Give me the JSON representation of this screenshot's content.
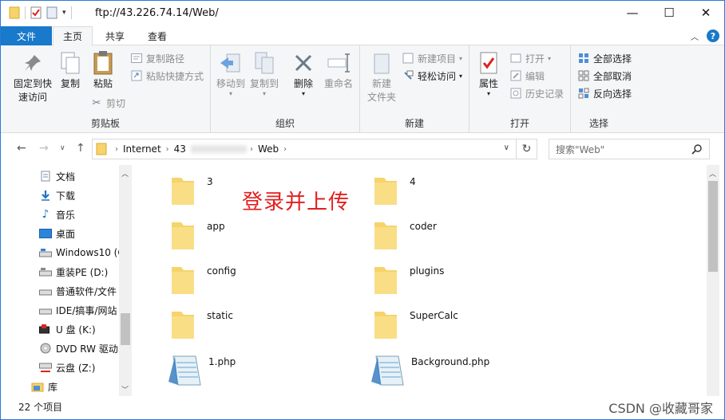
{
  "window": {
    "title": "ftp://43.226.74.14/Web/",
    "controls": {
      "minimize": "—",
      "maximize": "☐",
      "close": "✕"
    }
  },
  "ribbon_tabs": [
    {
      "label": "文件"
    },
    {
      "label": "主页"
    },
    {
      "label": "共享"
    },
    {
      "label": "查看"
    }
  ],
  "ribbon": {
    "clipboard": {
      "label": "剪贴板",
      "pin": "固定到快\n速访问",
      "copy": "复制",
      "paste": "粘贴",
      "copy_path": "复制路径",
      "paste_shortcut": "粘贴快捷方式",
      "cut": "剪切"
    },
    "organize": {
      "label": "组织",
      "move_to": "移动到",
      "copy_to": "复制到",
      "delete": "删除",
      "rename": "重命名"
    },
    "new": {
      "label": "新建",
      "new_folder": "新建\n文件夹",
      "new_item": "新建项目",
      "easy_access": "轻松访问"
    },
    "open": {
      "label": "打开",
      "properties": "属性",
      "open": "打开",
      "edit": "编辑",
      "history": "历史记录"
    },
    "select": {
      "label": "选择",
      "select_all": "全部选择",
      "select_none": "全部取消",
      "invert": "反向选择"
    }
  },
  "address": {
    "crumbs": [
      "Internet",
      "43",
      "Web"
    ],
    "search_placeholder": "搜索\"Web\""
  },
  "nav_items": [
    {
      "label": "文档",
      "icon": "document-icon"
    },
    {
      "label": "下载",
      "icon": "download-icon"
    },
    {
      "label": "音乐",
      "icon": "music-icon"
    },
    {
      "label": "桌面",
      "icon": "desktop-icon"
    },
    {
      "label": "Windows10 (C",
      "icon": "drive-icon"
    },
    {
      "label": "重装PE (D:)",
      "icon": "drive-icon"
    },
    {
      "label": "普通软件/文件",
      "icon": "drive-icon"
    },
    {
      "label": "IDE/搞事/网站",
      "icon": "drive-icon"
    },
    {
      "label": "U 盘 (K:)",
      "icon": "usb-drive-icon"
    },
    {
      "label": "DVD RW 驱动",
      "icon": "dvd-icon"
    },
    {
      "label": "云盘 (Z:)",
      "icon": "network-drive-icon"
    },
    {
      "label": "库",
      "icon": "library-icon"
    }
  ],
  "files": [
    {
      "name": "3",
      "type": "folder"
    },
    {
      "name": "4",
      "type": "folder"
    },
    {
      "name": "app",
      "type": "folder"
    },
    {
      "name": "coder",
      "type": "folder"
    },
    {
      "name": "config",
      "type": "folder"
    },
    {
      "name": "plugins",
      "type": "folder"
    },
    {
      "name": "static",
      "type": "folder"
    },
    {
      "name": "SuperCalc",
      "type": "folder"
    },
    {
      "name": "1.php",
      "type": "file"
    },
    {
      "name": "Background.php",
      "type": "file"
    }
  ],
  "annotation": "登录并上传",
  "status": {
    "count": "22 个项目"
  },
  "watermark": "CSDN @收藏哥家",
  "colors": {
    "accent": "#1979ca",
    "annotation": "#e41e1e",
    "folder": "#f6d36b"
  }
}
